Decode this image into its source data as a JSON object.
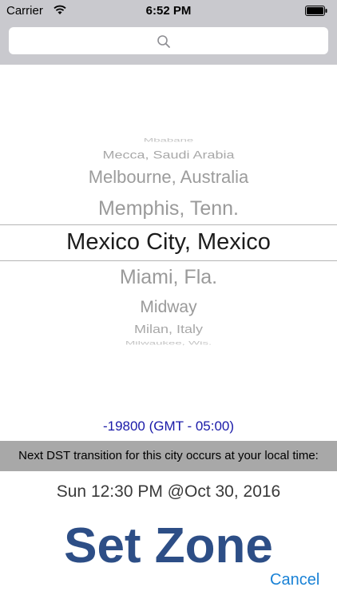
{
  "status_bar": {
    "carrier": "Carrier",
    "time": "6:52 PM",
    "wifi_icon": "wifi-icon",
    "battery_icon": "battery-icon"
  },
  "search": {
    "icon": "search-icon",
    "placeholder": ""
  },
  "picker": {
    "items": [
      "Mbabane",
      "Mecca, Saudi Arabia",
      "Melbourne, Australia",
      "Memphis, Tenn.",
      "Mexico City, Mexico",
      "Miami, Fla.",
      "Midway",
      "Milan, Italy",
      "Milwaukee, Wis."
    ],
    "selected": "Mexico City, Mexico"
  },
  "offset_text": "-19800 (GMT - 05:00)",
  "dst_label": "Next DST transition for this city occurs at your local time:",
  "dst_time": "Sun 12:30 PM @Oct 30, 2016",
  "set_zone_label": "Set Zone",
  "cancel_label": "Cancel",
  "colors": {
    "header_bg": "#c9c9ce",
    "offset_text": "#1a1aa8",
    "banner_bg": "#a8a8a8",
    "set_zone": "#2d4e86",
    "cancel": "#1a82d6"
  }
}
